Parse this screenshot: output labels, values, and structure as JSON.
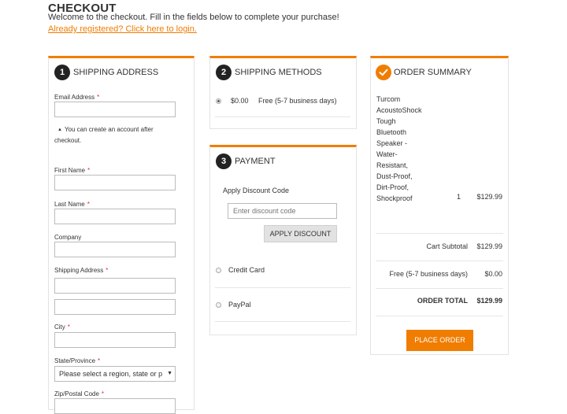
{
  "header": {
    "title": "CHECKOUT",
    "welcome": "Welcome to the checkout. Fill in the fields below to complete your purchase!",
    "login_link": "Already registered? Click here to login."
  },
  "shipping_address": {
    "step": "1",
    "title": "SHIPPING ADDRESS",
    "email_label": "Email Address",
    "account_hint_line1": "You can create an account after",
    "account_hint_line2": "checkout.",
    "first_name_label": "First Name",
    "last_name_label": "Last Name",
    "company_label": "Company",
    "address_label": "Shipping Address",
    "city_label": "City",
    "state_label": "State/Province",
    "state_value": "Please select a region, state or p",
    "zip_label": "Zip/Postal Code",
    "required_mark": "*"
  },
  "shipping_methods": {
    "step": "2",
    "title": "SHIPPING METHODS",
    "options": [
      {
        "price": "$0.00",
        "label": "Free (5-7 business days)",
        "selected": true
      }
    ]
  },
  "payment": {
    "step": "3",
    "title": "PAYMENT",
    "discount_label": "Apply Discount Code",
    "discount_placeholder": "Enter discount code",
    "apply_button": "APPLY DISCOUNT",
    "methods": [
      "Credit Card",
      "PayPal"
    ]
  },
  "order_summary": {
    "title": "ORDER SUMMARY",
    "item_name_lines": [
      "Turcom",
      "AcoustoShock",
      "Tough",
      "Bluetooth",
      "Speaker -",
      "Water-",
      "Resistant,",
      "Dust-Proof,",
      "Dirt-Proof,",
      "Shockproof"
    ],
    "item_qty": "1",
    "item_price": "$129.99",
    "subtotal_label": "Cart Subtotal",
    "subtotal_value": "$129.99",
    "shipping_label": "Free (5-7 business days)",
    "shipping_value": "$0.00",
    "total_label": "ORDER TOTAL",
    "total_value": "$129.99",
    "place_order": "PLACE ORDER"
  },
  "colors": {
    "accent": "#f07d00",
    "required": "#e02b27",
    "step_badge": "#222222"
  },
  "icons": {
    "hint": "caret-up-icon",
    "summary": "checkmark-icon"
  }
}
